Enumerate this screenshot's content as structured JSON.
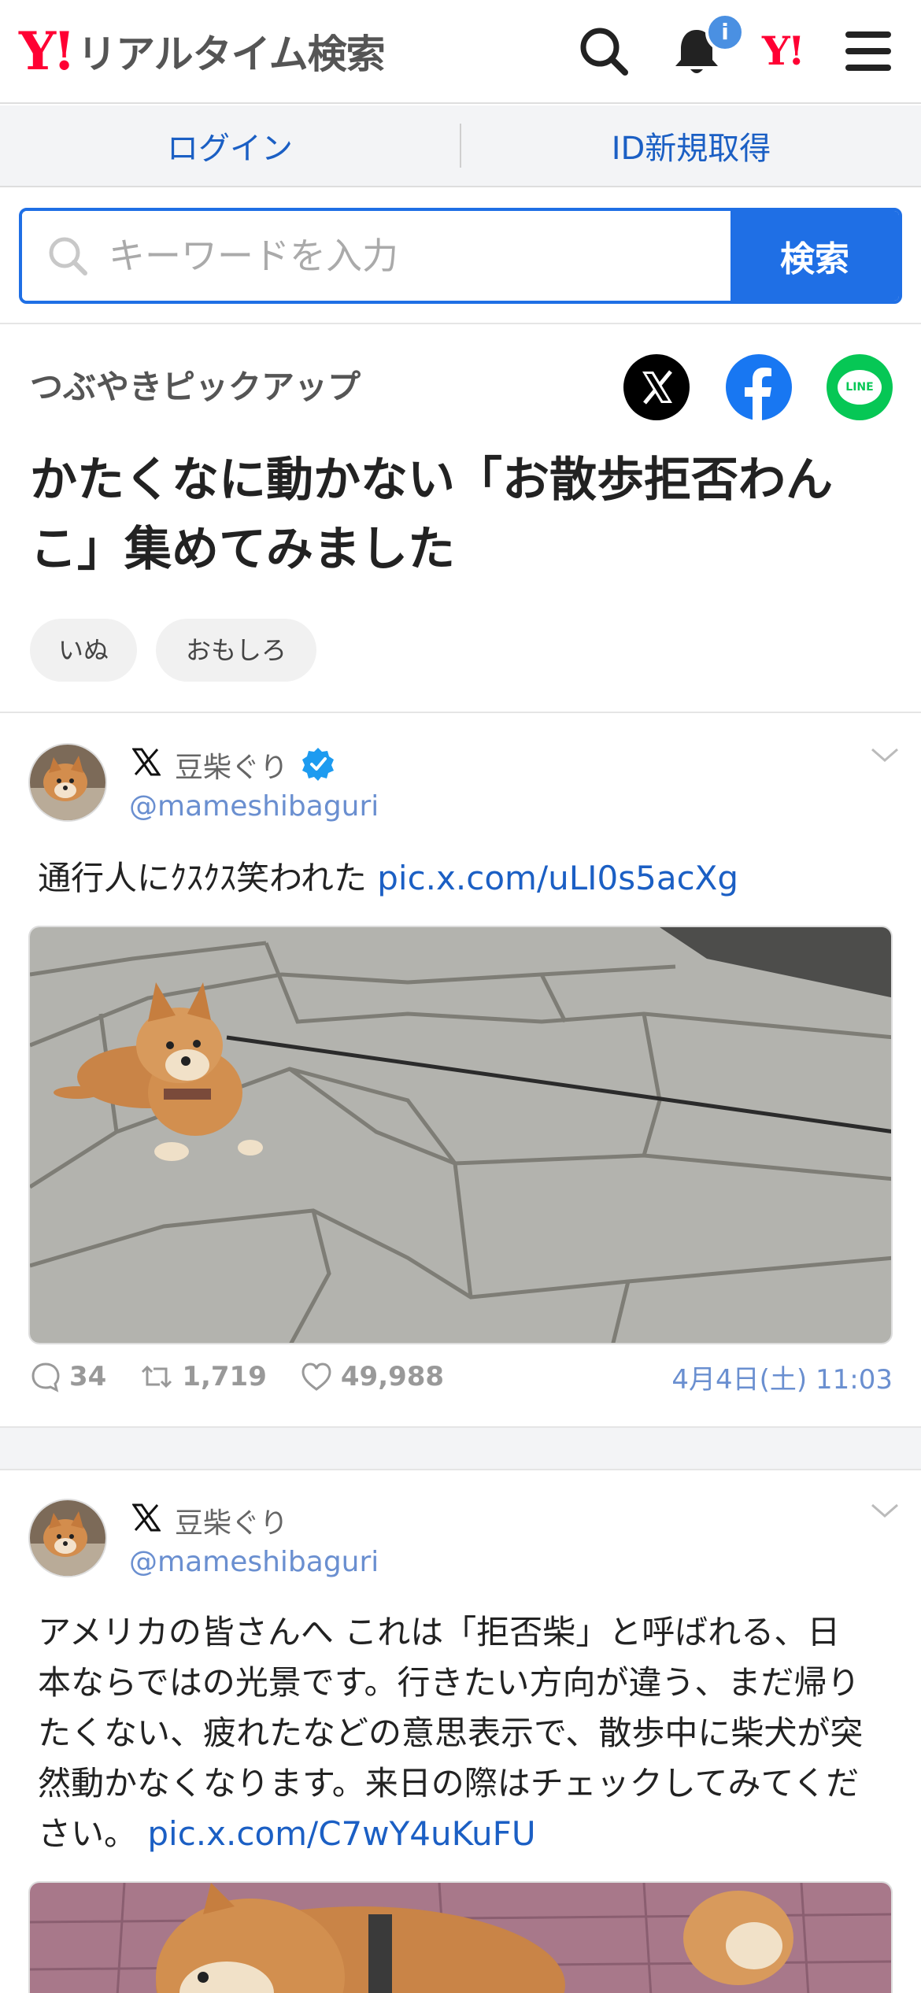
{
  "header": {
    "logo_mark": "Y!",
    "logo_text": "リアルタイム検索",
    "notification_badge": "i",
    "ylogo": "Y!"
  },
  "account": {
    "login": "ログイン",
    "register": "ID新規取得"
  },
  "search": {
    "placeholder": "キーワードを入力",
    "button": "検索"
  },
  "section": {
    "label": "つぶやきピックアップ",
    "title": "かたくなに動かない「お散歩拒否わんこ」集めてみました",
    "tags": [
      "いぬ",
      "おもしろ"
    ],
    "share_line_label": "LINE"
  },
  "tweets": [
    {
      "author": "豆柴ぐり",
      "handle": "@mameshibaguri",
      "verified": true,
      "text": "通行人にｸｽｸｽ笑われた",
      "link": "pic.x.com/uLI0s5acXg",
      "replies": "34",
      "retweets": "1,719",
      "likes": "49,988",
      "date": "4月4日(土) 11:03"
    },
    {
      "author": "豆柴ぐり",
      "handle": "@mameshibaguri",
      "verified": false,
      "text": "アメリカの皆さんへ これは「拒否柴」と呼ばれる、日本ならではの光景です。行きたい方向が違う、まだ帰りたくない、疲れたなどの意思表示で、散歩中に柴犬が突然動かなくなります。来日の際はチェックしてみてください。",
      "link": "pic.x.com/C7wY4uKuFU"
    }
  ],
  "colors": {
    "brand_red": "#ff0033",
    "accent_blue": "#1f6fe5",
    "link_blue": "#1b5fc4",
    "handle_blue": "#6a8fd0",
    "line_green": "#06c755",
    "facebook_blue": "#1877f2"
  },
  "icons": [
    "search-icon",
    "bell-icon",
    "menu-icon",
    "x-icon",
    "facebook-icon",
    "line-icon",
    "verified-icon",
    "chevron-down-icon",
    "reply-icon",
    "retweet-icon",
    "like-icon"
  ]
}
